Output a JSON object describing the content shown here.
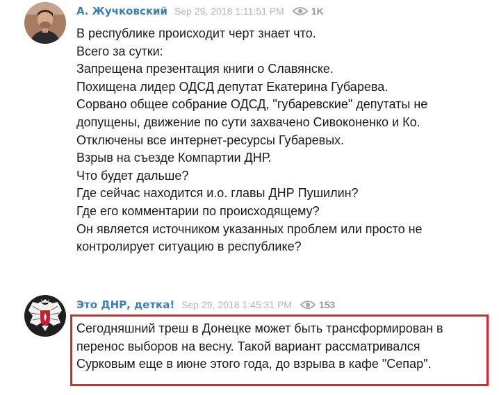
{
  "posts": [
    {
      "author": "А. Жучковский",
      "date": "Sep 29, 2018 1:11:51 PM",
      "views": "1K",
      "avatar_icon": "person-photo-icon",
      "lines": [
        "В республике происходит черт знает что.",
        "Всего за сутки:",
        "Запрещена презентация книги о Славянске.",
        "Похищена лидер ОДСД депутат Екатерина Губарева.",
        "Сорвано общее собрание ОДСД, \"губаревские\" депутаты не",
        "допущены, движение по сути захвачено Сивоконенко и Ко.",
        "Отключены все интернет-ресурсы Губаревых.",
        "Взрыв на съезде Компартии ДНР.",
        "Что будет дальше?",
        "Где сейчас находится и.о. главы ДНР Пушилин?",
        "Где его комментарии по происходящему?",
        "Он является источником указанных проблем или просто не",
        "контролирует ситуацию в республике?"
      ]
    },
    {
      "author": "Это ДНР, детка!",
      "date": "Sep 29, 2018 1:45:31 PM",
      "views": "153",
      "avatar_icon": "coat-of-arms-eagle-icon",
      "lines": [
        "Сегодняшний треш в Донецке может быть трансформирован в",
        "перенос выборов на весну. Такой вариант рассматривался",
        "Сурковым еще в июне этого года, до взрыва в кафе \"Сепар\"."
      ]
    }
  ],
  "colors": {
    "author": "#3d7fb5",
    "date": "#b5b5b5",
    "views": "#9a9a9a",
    "highlight": "#e0262b"
  },
  "icons": {
    "views": "eye-icon"
  }
}
